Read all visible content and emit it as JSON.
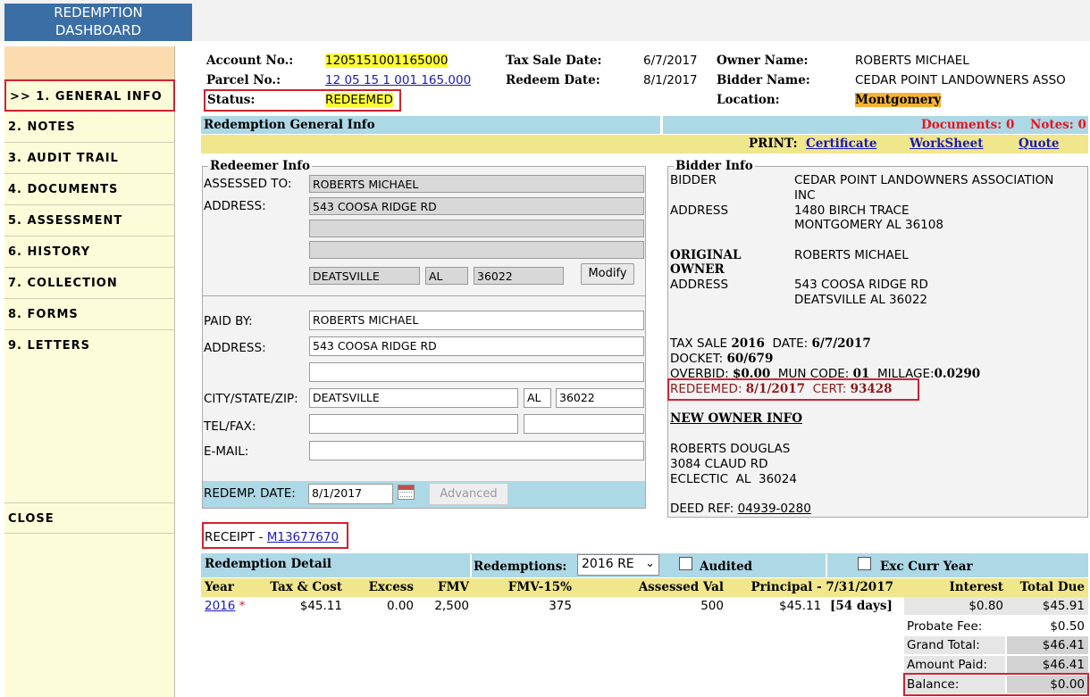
{
  "dashboard": {
    "title_line1": "REDEMPTION",
    "title_line2": "DASHBOARD"
  },
  "sidebar": {
    "items": [
      {
        "label": ">> 1. GENERAL INFO"
      },
      {
        "label": "2. NOTES"
      },
      {
        "label": "3. AUDIT TRAIL"
      },
      {
        "label": "4. DOCUMENTS"
      },
      {
        "label": "5. ASSESSMENT"
      },
      {
        "label": "6. HISTORY"
      },
      {
        "label": "7. COLLECTION"
      },
      {
        "label": "8. FORMS"
      },
      {
        "label": "9. LETTERS"
      }
    ],
    "close_label": "CLOSE"
  },
  "header": {
    "account_label": "Account No.:",
    "account_value": "1205151001165000",
    "parcel_label": "Parcel No.:",
    "parcel_value": "12 05 15 1 001 165.000",
    "status_label": "Status:",
    "status_value": "REDEEMED",
    "tax_sale_label": "Tax Sale Date:",
    "tax_sale_value": "6/7/2017",
    "redeem_label": "Redeem Date:",
    "redeem_value": "8/1/2017",
    "owner_label": "Owner Name:",
    "owner_value": "ROBERTS MICHAEL",
    "bidder_label": "Bidder Name:",
    "bidder_value": "CEDAR POINT LANDOWNERS ASSO",
    "location_label": "Location:",
    "location_value": "Montgomery"
  },
  "section_bar": {
    "title": "Redemption General Info",
    "documents": "Documents: 0",
    "notes": "Notes: 0"
  },
  "print_bar": {
    "label": "PRINT:",
    "certificate": "Certificate",
    "worksheet": "WorkSheet",
    "quote": "Quote"
  },
  "redeemer": {
    "legend": "Redeemer Info",
    "assessed_label": "ASSESSED TO:",
    "assessed_value": "ROBERTS MICHAEL",
    "address_label": "ADDRESS:",
    "address1": "543 COOSA RIDGE RD",
    "address2": "",
    "address3": "",
    "city": "DEATSVILLE",
    "state": "AL",
    "zip": "36022",
    "modify_label": "Modify",
    "paid_by_label": "PAID BY:",
    "paid_by_value": "ROBERTS MICHAEL",
    "paid_address_label": "ADDRESS:",
    "paid_address1": "543 COOSA RIDGE RD",
    "paid_address2": "",
    "csz_label": "CITY/STATE/ZIP:",
    "paid_city": "DEATSVILLE",
    "paid_state": "AL",
    "paid_zip": "36022",
    "telfax_label": "TEL/FAX:",
    "tel": "",
    "fax": "",
    "email_label": "E-MAIL:",
    "email": "",
    "redemp_date_label": "REDEMP. DATE:",
    "redemp_date": "8/1/2017",
    "advanced_label": "Advanced"
  },
  "bidder": {
    "legend": "Bidder Info",
    "bidder_label": "BIDDER",
    "bidder_line1": "CEDAR POINT LANDOWNERS ASSOCIATION",
    "bidder_line2": "INC",
    "address_label": "ADDRESS",
    "address_line1": "1480 BIRCH TRACE",
    "address_line2": "MONTGOMERY AL 36108",
    "orig_owner_label1": "ORIGINAL",
    "orig_owner_label2": "OWNER",
    "orig_owner_value": "ROBERTS MICHAEL",
    "orig_address_label": "ADDRESS",
    "orig_address_line1": "543 COOSA RIDGE RD",
    "orig_address_line2": "DEATSVILLE AL 36022",
    "tax_sale_prefix": "TAX SALE ",
    "tax_sale_year": "2016",
    "tax_sale_date_prefix": "  DATE: ",
    "tax_sale_date": "6/7/2017",
    "docket_prefix": "DOCKET: ",
    "docket": "60/679",
    "overbid_prefix": "OVERBID: ",
    "overbid": "$0.00",
    "mun_prefix": "  MUN CODE: ",
    "mun": "01",
    "millage_prefix": "  MILLAGE:",
    "millage": "0.0290",
    "redeemed_prefix": "REDEEMED: ",
    "redeemed": "8/1/2017",
    "cert_prefix": "  CERT: ",
    "cert": "93428",
    "new_owner_heading": "NEW OWNER INFO",
    "new_owner_name": "ROBERTS DOUGLAS",
    "new_owner_addr1": "3084 CLAUD RD",
    "new_owner_addr2": "ECLECTIC  AL  36024",
    "deed_prefix": "DEED REF: ",
    "deed": "04939-0280"
  },
  "receipt": {
    "label": "RECEIPT - ",
    "number": "M13677670"
  },
  "detail_bar": {
    "title": "Redemption Detail",
    "redemptions_label": "Redemptions:",
    "redemptions_value": "2016 RE",
    "audited_label": "Audited",
    "exc_label": "Exc Curr Year"
  },
  "detail_table": {
    "headers": [
      "Year",
      "Tax & Cost",
      "Excess",
      "FMV",
      "FMV-15%",
      "Assessed Val",
      "Principal - 7/31/2017",
      "Interest",
      "Total Due"
    ],
    "row": {
      "year": "2016",
      "star": "*",
      "tax_cost": "$45.11",
      "excess": "0.00",
      "fmv": "2,500",
      "fmv15": "375",
      "assessed": "500",
      "principal": "$45.11",
      "days": "[54 days]",
      "interest": "$0.80",
      "total_due": "$45.91"
    }
  },
  "totals": [
    {
      "label": "Probate Fee:",
      "value": "$0.50"
    },
    {
      "label": "Grand Total:",
      "value": "$46.41"
    },
    {
      "label": "Amount Paid:",
      "value": "$46.41"
    },
    {
      "label": "Balance:",
      "value": "$0.00"
    }
  ]
}
